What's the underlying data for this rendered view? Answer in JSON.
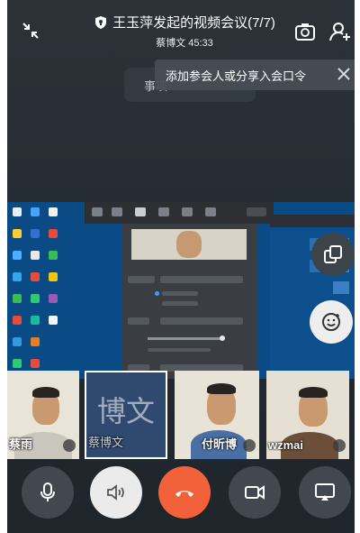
{
  "header": {
    "title": "王玉萍发起的视频会议(7/7)",
    "host_and_time": "蔡博文 45:33"
  },
  "tip": {
    "text": "添加参会人或分享入会口令"
  },
  "ghost_label": {
    "text": "事项"
  },
  "participants": [
    {
      "name": "蔡雨"
    },
    {
      "name": "蔡博文",
      "initials": "博文"
    },
    {
      "name": "付昕博"
    },
    {
      "name": "wzmai"
    }
  ],
  "colors": {
    "hangup": "#f2613a",
    "background": "#252c33",
    "speaker_button": "#ebebeb",
    "active_border": "#ffffff"
  },
  "icons": {
    "top_left": "collapse-icon",
    "title_badge": "shield-icon",
    "camera_switch": "camera-switch-icon",
    "add_person": "add-person-icon",
    "tip_close": "close-icon",
    "layout": "layout-switch-icon",
    "reaction": "emoji-icon",
    "mic": "microphone-icon",
    "speaker": "speaker-icon",
    "hangup": "hang-up-icon",
    "video": "video-camera-icon",
    "share": "screen-share-icon"
  }
}
